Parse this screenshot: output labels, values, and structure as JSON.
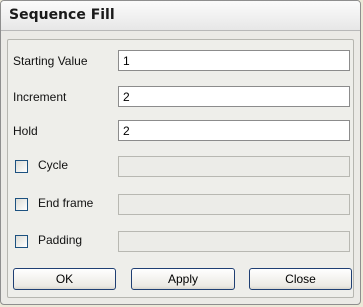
{
  "window": {
    "title": "Sequence Fill"
  },
  "fields": {
    "starting_value": {
      "label": "Starting Value",
      "value": "1"
    },
    "increment": {
      "label": "Increment",
      "value": "2"
    },
    "hold": {
      "label": "Hold",
      "value": "2"
    }
  },
  "options": {
    "cycle": {
      "label": "Cycle",
      "checked": false,
      "value": ""
    },
    "end_frame": {
      "label": "End frame",
      "checked": false,
      "value": ""
    },
    "padding": {
      "label": "Padding",
      "checked": false,
      "value": ""
    }
  },
  "buttons": {
    "ok": "OK",
    "apply": "Apply",
    "close": "Close"
  }
}
